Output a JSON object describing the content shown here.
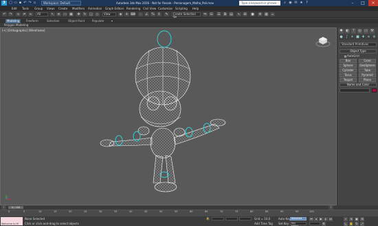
{
  "titlebar": {
    "logo": "3",
    "workspace": "Workspace: Default",
    "title": "Autodesk 3ds Max 2016 - Not for Resale - Personagem_Malha_Poli.max",
    "search_placeholder": "Type a keyword or phrase"
  },
  "menu": [
    "Edit",
    "Tools",
    "Group",
    "Views",
    "Create",
    "Modifiers",
    "Animation",
    "Graph Editors",
    "Rendering",
    "Civil View",
    "Customize",
    "Scripting",
    "Help"
  ],
  "toolbar": {
    "selection_filter": "All",
    "view_dropdown": "View",
    "named_selection": "Create Selection Se"
  },
  "ribbon": {
    "tabs": [
      "Modeling",
      "Freeform",
      "Selection",
      "Object Paint",
      "Populate"
    ],
    "active_tab": "Modeling",
    "subtitle": "Polygon Modeling"
  },
  "viewport": {
    "label": "[+] [Orthographic] [Wireframe]"
  },
  "command_panel": {
    "category": "Standard Primitives",
    "object_type_header": "Object Type",
    "autogrid_label": "AutoGrid",
    "buttons": [
      "Box",
      "Cone",
      "Sphere",
      "GeoSphere",
      "Cylinder",
      "Tube",
      "Torus",
      "Pyramid",
      "Teapot",
      "Plane"
    ],
    "name_color_header": "Name and Color",
    "swatch_color": "#9b1542"
  },
  "timeline": {
    "slider_label": "0 / 100",
    "ticks": [
      "0",
      "5",
      "10",
      "15",
      "20",
      "25",
      "30",
      "35",
      "40",
      "45",
      "50",
      "55",
      "60",
      "65",
      "70",
      "75",
      "80",
      "85",
      "90",
      "95",
      "100"
    ]
  },
  "statusbar": {
    "maxscript_label": "Welcome to M",
    "status": "None Selected",
    "prompt": "Click or click-and-drag to select objects",
    "grid": "Grid = 10,0",
    "add_time_tag": "Add Time Tag",
    "auto_key": "Auto Key",
    "set_key": "Set Key",
    "selected": "Selected",
    "key_filters": "Key Filters..."
  }
}
